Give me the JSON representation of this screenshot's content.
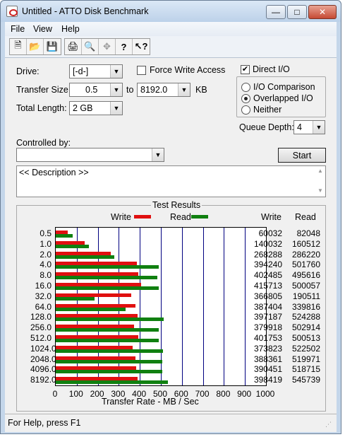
{
  "window": {
    "title": "Untitled - ATTO Disk Benchmark",
    "minimize_glyph": "—",
    "maximize_glyph": "□",
    "close_glyph": "✕"
  },
  "menu": {
    "items": [
      "File",
      "View",
      "Help"
    ]
  },
  "toolbar": {
    "icons": [
      "new-icon",
      "open-icon",
      "save-icon",
      "print-icon",
      "print-preview-icon",
      "move-icon",
      "help-icon",
      "context-help-icon"
    ]
  },
  "settings": {
    "drive_label": "Drive:",
    "drive_value": "[-d-]",
    "transfer_size_label": "Transfer Size:",
    "transfer_from": "0.5",
    "to_label": "to",
    "transfer_to": "8192.0",
    "kb_label": "KB",
    "total_length_label": "Total Length:",
    "total_length_value": "2 GB",
    "force_write_access_label": "Force Write Access",
    "force_write_access_checked": false,
    "direct_io_label": "Direct I/O",
    "direct_io_checked": true,
    "io_options": [
      {
        "label": "I/O Comparison",
        "selected": false
      },
      {
        "label": "Overlapped I/O",
        "selected": true
      },
      {
        "label": "Neither",
        "selected": false
      }
    ],
    "queue_depth_label": "Queue Depth:",
    "queue_depth_value": "4",
    "controlled_by_label": "Controlled by:",
    "controlled_by_value": "",
    "start_label": "Start",
    "description_text": "<< Description >>"
  },
  "results": {
    "title": "Test Results",
    "legend_write": "Write",
    "legend_read": "Read",
    "col_write": "Write",
    "col_read": "Read",
    "write_color": "#e01010",
    "read_color": "#108010",
    "xlabel": "Transfer Rate - MB / Sec"
  },
  "chart_data": {
    "type": "bar",
    "orientation": "horizontal",
    "title": "Test Results",
    "xlabel": "Transfer Rate - MB / Sec",
    "xlim": [
      0,
      1000
    ],
    "xticks": [
      "0",
      "100",
      "200",
      "300",
      "400",
      "500",
      "600",
      "700",
      "800",
      "900",
      "1000"
    ],
    "categories": [
      "0.5",
      "1.0",
      "2.0",
      "4.0",
      "8.0",
      "16.0",
      "32.0",
      "64.0",
      "128.0",
      "256.0",
      "512.0",
      "1024.0",
      "2048.0",
      "4096.0",
      "8192.0"
    ],
    "series": [
      {
        "name": "Write",
        "values_kb": [
          60032,
          140032,
          268288,
          394240,
          402485,
          415713,
          366805,
          387404,
          397187,
          379918,
          401753,
          373823,
          388361,
          390451,
          398419
        ]
      },
      {
        "name": "Read",
        "values_kb": [
          82048,
          160512,
          286220,
          501760,
          495616,
          500057,
          190511,
          339816,
          524288,
          502914,
          500513,
          522502,
          519971,
          518715,
          545739
        ]
      }
    ],
    "grid": true,
    "legend_position": "top"
  },
  "status": {
    "text": "For Help, press F1"
  }
}
